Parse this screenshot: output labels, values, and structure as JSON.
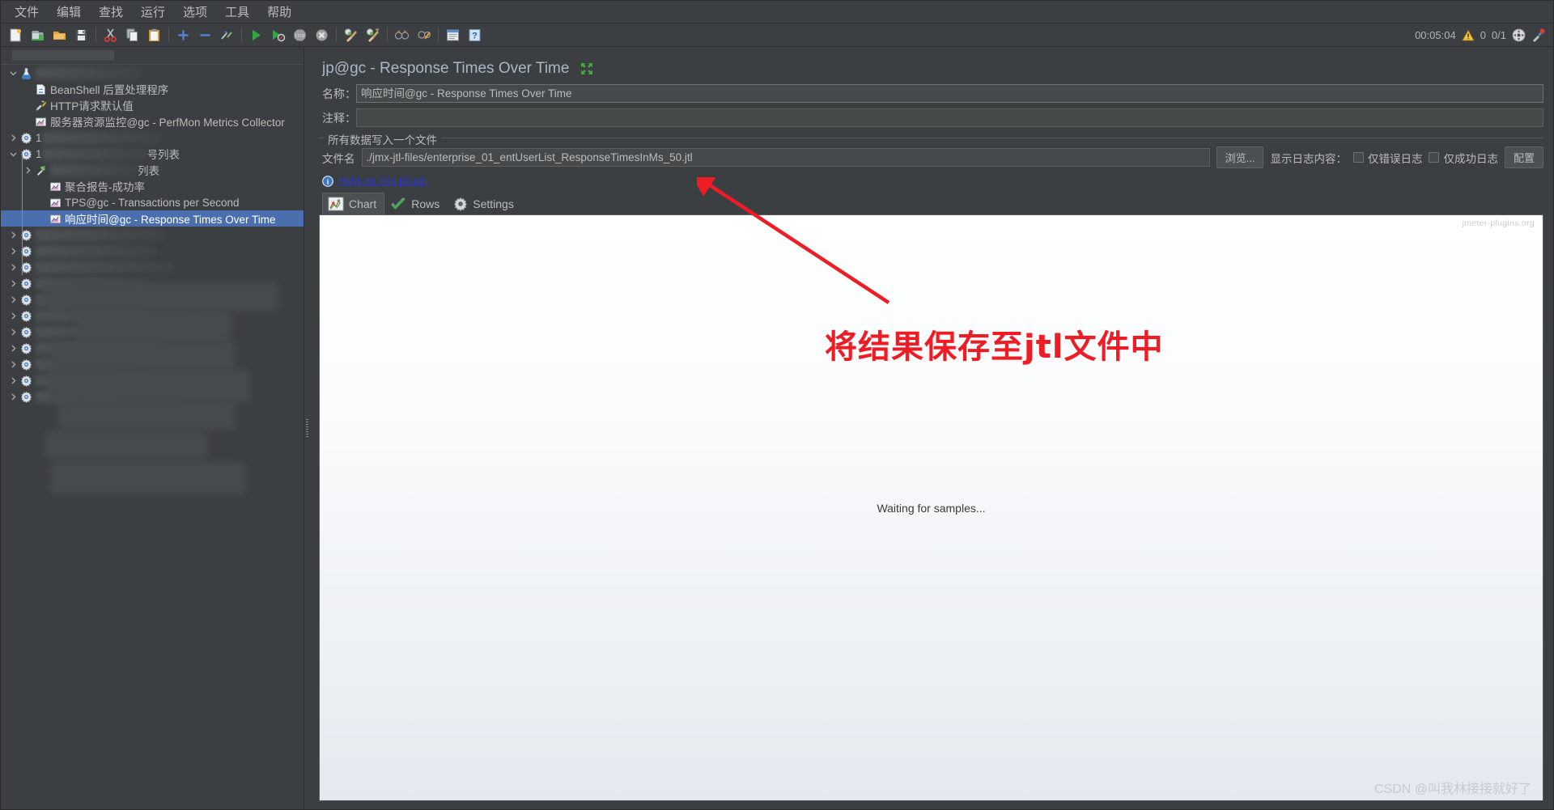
{
  "window": {
    "menubar": [
      {
        "label": "文件",
        "name": "menu-file"
      },
      {
        "label": "编辑",
        "name": "menu-edit"
      },
      {
        "label": "查找",
        "name": "menu-search"
      },
      {
        "label": "运行",
        "name": "menu-run"
      },
      {
        "label": "选项",
        "name": "menu-options"
      },
      {
        "label": "工具",
        "name": "menu-tools"
      },
      {
        "label": "帮助",
        "name": "menu-help"
      }
    ]
  },
  "toolbar": {
    "buttons": [
      {
        "name": "new-icon",
        "title": "新建"
      },
      {
        "name": "templates-icon",
        "title": "模板"
      },
      {
        "name": "open-icon",
        "title": "打开"
      },
      {
        "name": "save-icon",
        "title": "保存"
      },
      {
        "name": "cut-icon",
        "title": "剪切"
      },
      {
        "name": "copy-icon",
        "title": "复制"
      },
      {
        "name": "paste-icon",
        "title": "粘贴"
      },
      {
        "name": "expand-all-icon",
        "title": "展开全部"
      },
      {
        "name": "collapse-all-icon",
        "title": "折叠全部"
      },
      {
        "name": "toggle-icon",
        "title": "启用/禁用"
      },
      {
        "name": "start-icon",
        "title": "启动"
      },
      {
        "name": "start-no-pause-icon",
        "title": "无间隔启动"
      },
      {
        "name": "stop-icon",
        "title": "停止"
      },
      {
        "name": "shutdown-icon",
        "title": "关闭"
      },
      {
        "name": "clear-icon",
        "title": "清除"
      },
      {
        "name": "clear-all-icon",
        "title": "清除全部"
      },
      {
        "name": "search-icon",
        "title": "查找"
      },
      {
        "name": "reset-search-icon",
        "title": "重置查找"
      },
      {
        "name": "function-helper-icon",
        "title": "函数助手"
      },
      {
        "name": "help-icon",
        "title": "帮助"
      }
    ],
    "status": {
      "elapsed": "00:05:04",
      "warning_count": "0",
      "threads": "0/1"
    }
  },
  "tree": {
    "search_value": "",
    "items": [
      {
        "name": "test-plan",
        "label": "",
        "icon": "test-plan-icon",
        "indent": 0,
        "toggle": "down",
        "redacted": true,
        "redact_w": 132
      },
      {
        "name": "beanshell-postprocessor",
        "label": "BeanShell 后置处理程序",
        "icon": "beanshell-icon",
        "indent": 1,
        "toggle": "none",
        "redacted": false
      },
      {
        "name": "http-request-defaults",
        "label": "HTTP请求默认值",
        "icon": "http-defaults-icon",
        "indent": 1,
        "toggle": "none",
        "redacted": false
      },
      {
        "name": "perfmon-metrics-collector",
        "label": "服务器资源监控@gc - PerfMon Metrics Collector",
        "icon": "listener-chart-icon",
        "indent": 1,
        "toggle": "none",
        "redacted": false
      },
      {
        "name": "thread-group-1",
        "label": "1",
        "icon": "gear-icon",
        "indent": 0,
        "toggle": "right",
        "redacted": true,
        "redact_w": 148
      },
      {
        "name": "thread-group-2",
        "label": "1",
        "suffix": "号列表",
        "icon": "gear-icon",
        "indent": 0,
        "toggle": "down",
        "redacted": true,
        "redact_w": 130
      },
      {
        "name": "sampler-list",
        "label": "",
        "suffix": "列表",
        "icon": "sampler-icon",
        "indent": 1,
        "toggle": "right",
        "redacted": true,
        "redact_w": 108
      },
      {
        "name": "aggregate-report-success-rate",
        "label": "聚合报告-成功率",
        "icon": "listener-chart-icon",
        "indent": 2,
        "toggle": "none",
        "redacted": false
      },
      {
        "name": "tps-transactions-per-second",
        "label": "TPS@gc - Transactions per Second",
        "icon": "listener-chart-icon",
        "indent": 2,
        "toggle": "none",
        "redacted": false
      },
      {
        "name": "response-times-over-time",
        "label": "响应时间@gc - Response Times Over Time",
        "icon": "listener-chart-icon",
        "indent": 2,
        "toggle": "none",
        "redacted": false,
        "selected": true
      },
      {
        "name": "thread-group-3",
        "label": "",
        "icon": "gear-icon",
        "indent": 0,
        "toggle": "right",
        "redacted": true,
        "redact_w": 160
      },
      {
        "name": "thread-group-4",
        "label": "",
        "icon": "gear-icon",
        "indent": 0,
        "toggle": "right",
        "redacted": true,
        "redact_w": 150
      },
      {
        "name": "thread-group-5",
        "label": "",
        "icon": "gear-icon",
        "indent": 0,
        "toggle": "right",
        "redacted": true,
        "redact_w": 170
      },
      {
        "name": "thread-group-6",
        "label": "",
        "icon": "gear-icon",
        "indent": 0,
        "toggle": "right",
        "redacted": true,
        "redact_w": 140
      },
      {
        "name": "thread-group-7",
        "label": "",
        "icon": "gear-icon",
        "indent": 0,
        "toggle": "right",
        "redacted": true,
        "redact_w": 185
      },
      {
        "name": "thread-group-8",
        "label": "",
        "icon": "gear-icon",
        "indent": 0,
        "toggle": "right",
        "redacted": true,
        "redact_w": 200
      },
      {
        "name": "thread-group-9",
        "label": "",
        "icon": "gear-icon",
        "indent": 0,
        "toggle": "right",
        "redacted": true,
        "redact_w": 145
      },
      {
        "name": "thread-group-10",
        "label": "",
        "icon": "gear-icon",
        "indent": 0,
        "toggle": "right",
        "redacted": true,
        "redact_w": 155
      },
      {
        "name": "thread-group-11",
        "label": "",
        "icon": "gear-icon",
        "indent": 0,
        "toggle": "right",
        "redacted": true,
        "redact_w": 130
      },
      {
        "name": "thread-group-12",
        "label": "",
        "icon": "gear-icon",
        "indent": 0,
        "toggle": "right",
        "redacted": true,
        "redact_w": 120
      },
      {
        "name": "thread-group-13",
        "label": "",
        "icon": "gear-icon",
        "indent": 0,
        "toggle": "right",
        "redacted": true,
        "redact_w": 175
      }
    ]
  },
  "panel": {
    "title": "jp@gc - Response Times Over Time",
    "expand_icon": "expand-arrows-icon",
    "name_label": "名称：",
    "name_value": "响应时间@gc - Response Times Over Time",
    "comment_label": "注释：",
    "comment_value": "",
    "group_title": "所有数据写入一个文件",
    "filename_label": "文件名",
    "filename_value": "./jmx-jtl-files/enterprise_01_entUserList_ResponseTimesInMs_50.jtl",
    "browse_button": "浏览...",
    "log_display_label": "显示日志内容：",
    "errors_only_label": "仅错误日志",
    "errors_only_checked": false,
    "successes_only_label": "仅成功日志",
    "successes_only_checked": false,
    "configure_button": "配置",
    "help_link": "Help on this plugin",
    "tabs": [
      {
        "label": "Chart",
        "name": "tab-chart",
        "icon": "chart-icon",
        "active": true
      },
      {
        "label": "Rows",
        "name": "tab-rows",
        "icon": "check-icon",
        "active": false
      },
      {
        "label": "Settings",
        "name": "tab-settings",
        "icon": "gear-icon",
        "active": false
      }
    ]
  },
  "chart_data": {
    "type": "line",
    "title": "jp@gc - Response Times Over Time",
    "status_message": "Waiting for samples...",
    "watermark": "jmeter-plugins.org",
    "xlabel": "",
    "ylabel": "",
    "series": [],
    "categories": [],
    "values": [],
    "grid": false,
    "legend": "none"
  },
  "annotation": {
    "text": "将结果保存至jtl文件中",
    "color": "#ee1c24",
    "arrow_name": "red-arrow-pointer"
  },
  "watermarks": {
    "csdn": "CSDN @叫我林接接就好了"
  }
}
